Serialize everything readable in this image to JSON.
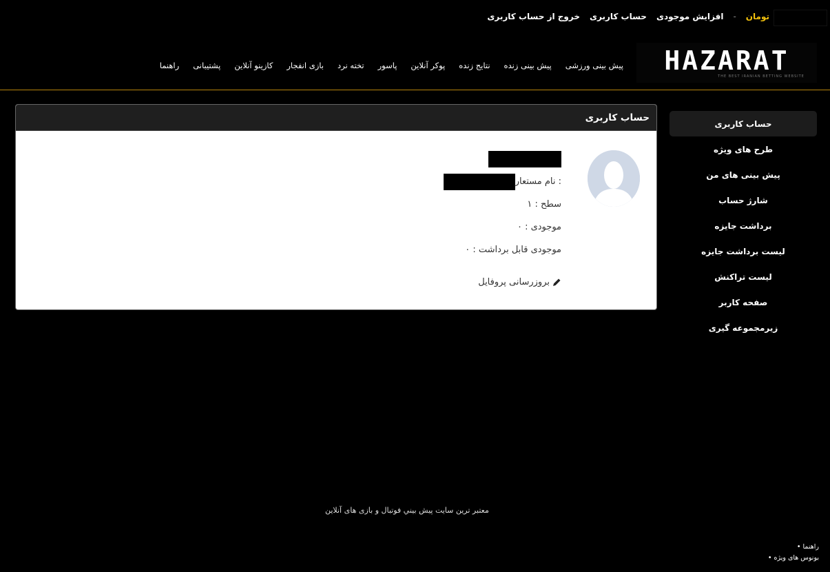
{
  "topbar": {
    "currency": "تومان",
    "separator": "-",
    "increase_balance": "افزایش موجودی",
    "account": "حساب کاربری",
    "logout": "خروج از حساب کاربری"
  },
  "logo": {
    "text": "HAZARAT",
    "tagline": "THE BEST IRANIAN BETTING WEBSITE"
  },
  "nav": [
    "پیش بینی ورزشی",
    "پیش بینی زنده",
    "نتایج زنده",
    "پوکر آنلاین",
    "پاسور",
    "تخته نرد",
    "بازی انفجار",
    "کازینو آنلاین",
    "پشتیبانی",
    "راهنما"
  ],
  "sidebar": [
    "حساب کاربری",
    "طرح های ویژه",
    "پیش بینی های من",
    "شارژ حساب",
    "برداشت جایزه",
    "لیست برداشت جایزه",
    "لیست تراکنش",
    "صفحه کاربر",
    "زیرمجموعه گیری"
  ],
  "card": {
    "title": "حساب کاربری",
    "nickname_label": "نام مستعار :",
    "level_label": "سطح : ۱",
    "balance_label": "موجودی : ۰",
    "withdrawable_label": "موجودی قابل برداشت : ۰",
    "edit_profile": "بروزرسانی پروفایل"
  },
  "footer": {
    "tagline": "معتبر ترین سایت پیش بيني فوتبال و بازی های آنلاین",
    "links": [
      "• راهنما",
      "• بونوس های ویژه"
    ]
  },
  "colors": {
    "accent": "#f4c20d",
    "divider": "#b8860b"
  }
}
